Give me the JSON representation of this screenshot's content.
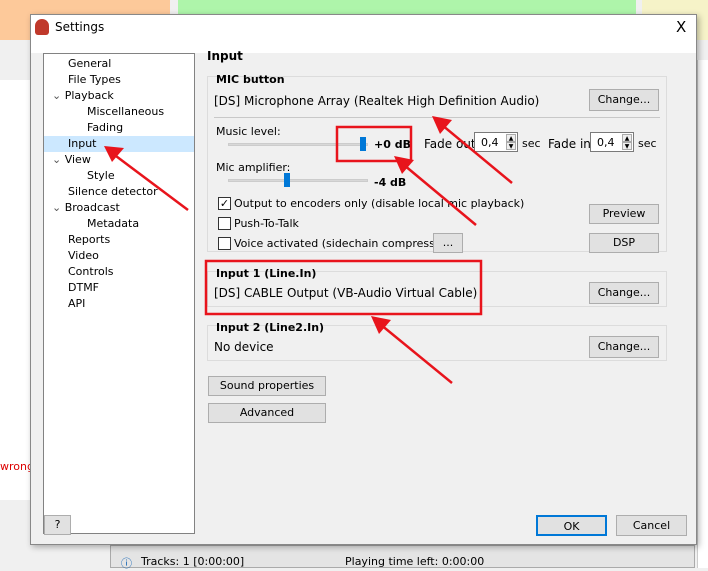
{
  "window": {
    "title": "Settings",
    "close": "X"
  },
  "tree": [
    {
      "label": "General",
      "level": 1
    },
    {
      "label": "File Types",
      "level": 1
    },
    {
      "label": "Playback",
      "level": 0,
      "expanded": true
    },
    {
      "label": "Miscellaneous",
      "level": 2
    },
    {
      "label": "Fading",
      "level": 2
    },
    {
      "label": "Input",
      "level": 0,
      "selected": true
    },
    {
      "label": "View",
      "level": 0,
      "expanded": true
    },
    {
      "label": "Style",
      "level": 2
    },
    {
      "label": "Silence detector",
      "level": 1
    },
    {
      "label": "Broadcast",
      "level": 0,
      "expanded": true
    },
    {
      "label": "Metadata",
      "level": 2
    },
    {
      "label": "Reports",
      "level": 1
    },
    {
      "label": "Video",
      "level": 1
    },
    {
      "label": "Controls",
      "level": 1
    },
    {
      "label": "DTMF",
      "level": 1
    },
    {
      "label": "API",
      "level": 1
    }
  ],
  "page_title": "Input",
  "mic": {
    "group": "MIC button",
    "device": "[DS] Microphone Array (Realtek High Definition Audio)",
    "change": "Change...",
    "music_level_label": "Music level:",
    "music_level_value": "+0 dB",
    "music_level_db": 0,
    "mic_amp_label": "Mic amplifier:",
    "mic_amp_value": "-4 dB",
    "mic_amp_db": -4,
    "fade_out_label": "Fade out",
    "fade_out_value": "0,4",
    "fade_in_label": "Fade in",
    "fade_in_value": "0,4",
    "sec": "sec",
    "output_encoders": "Output to encoders only (disable local mic playback)",
    "output_encoders_checked": true,
    "push_to_talk": "Push-To-Talk",
    "push_to_talk_checked": false,
    "voice_activated": "Voice activated (sidechain compression)",
    "voice_activated_checked": false,
    "more": "...",
    "preview": "Preview",
    "dsp": "DSP"
  },
  "input1": {
    "group": "Input 1 (Line.In)",
    "device": "[DS] CABLE Output (VB-Audio Virtual Cable)",
    "change": "Change..."
  },
  "input2": {
    "group": "Input 2 (Line2.In)",
    "device": "No device",
    "change": "Change..."
  },
  "buttons": {
    "sound_properties": "Sound properties",
    "advanced": "Advanced",
    "help": "?",
    "ok": "OK",
    "cancel": "Cancel"
  },
  "background": {
    "status_tracks": "Tracks: 1 [0:00:00]",
    "status_time": "Playing time left: 0:00:00",
    "wrong": "wrong"
  },
  "colors": {
    "accent": "#0078d7",
    "annotation": "#e8141c"
  }
}
